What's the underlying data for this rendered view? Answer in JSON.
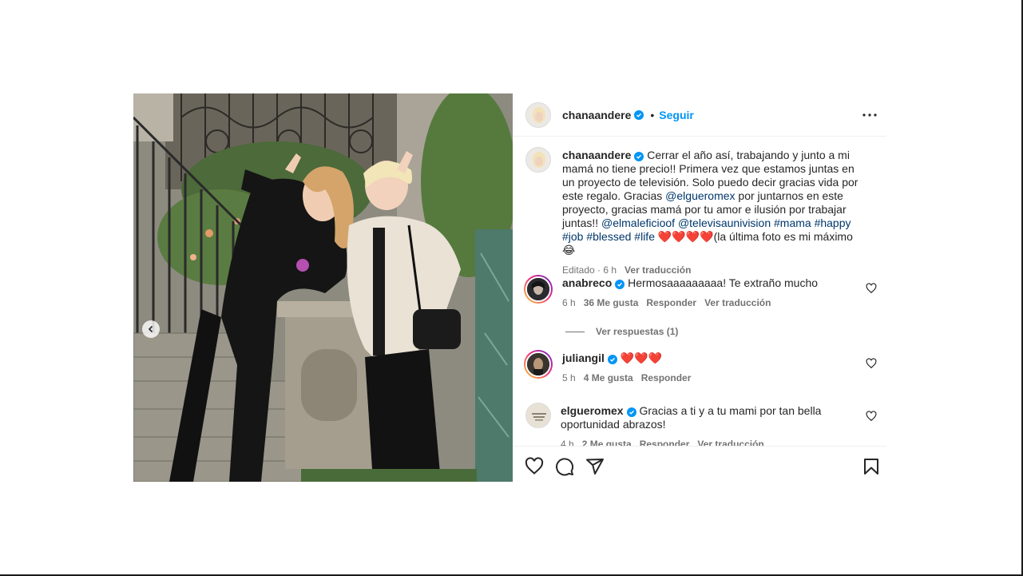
{
  "post": {
    "author": {
      "username": "chanaandere",
      "verified": true,
      "separator": "•",
      "follow_label": "Seguir"
    },
    "caption": {
      "username": "chanaandere",
      "parts": [
        " Cerrar el año así, trabajando y junto a mi mamá no tiene precio!! Primera vez que estamos juntas en un proyecto de televisión. Solo puedo decir gracias vida por este regalo. Gracias ",
        "@elgueromex",
        " por juntarnos en este proyecto, gracias mamá por tu amor e ilusión por trabajar juntas!! ",
        "@elmaleficioof",
        " ",
        "@televisaunivision",
        " ",
        "#mama",
        " ",
        "#happy",
        " ",
        "#job",
        " ",
        "#blessed",
        " ",
        "#life",
        " ",
        "❤️❤️❤️❤️",
        "(la última foto es mi máximo 😂"
      ],
      "edited": "Editado · 6 h",
      "translate": "Ver traducción"
    },
    "comments": [
      {
        "username": "anabreco",
        "verified": true,
        "text": "Hermosaaaaaaaaa! Te extraño mucho",
        "time": "6 h",
        "likes": "36 Me gusta",
        "reply": "Responder",
        "translate": "Ver traducción",
        "view_replies": "Ver respuestas (1)"
      },
      {
        "username": "juliangil",
        "verified": true,
        "text": "❤️❤️❤️",
        "time": "5 h",
        "likes": "4 Me gusta",
        "reply": "Responder"
      },
      {
        "username": "elgueromex",
        "verified": true,
        "text": "Gracias a ti y a tu mami por tan bella oportunidad abrazos!",
        "time": "4 h",
        "likes": "2 Me gusta",
        "reply": "Responder",
        "translate": "Ver traducción"
      }
    ],
    "action_icons": [
      "heart-icon",
      "comment-icon",
      "share-icon",
      "bookmark-icon"
    ]
  },
  "colors": {
    "link_blue": "#0095f6",
    "mention_blue": "#00376b",
    "secondary_text": "#737373"
  }
}
